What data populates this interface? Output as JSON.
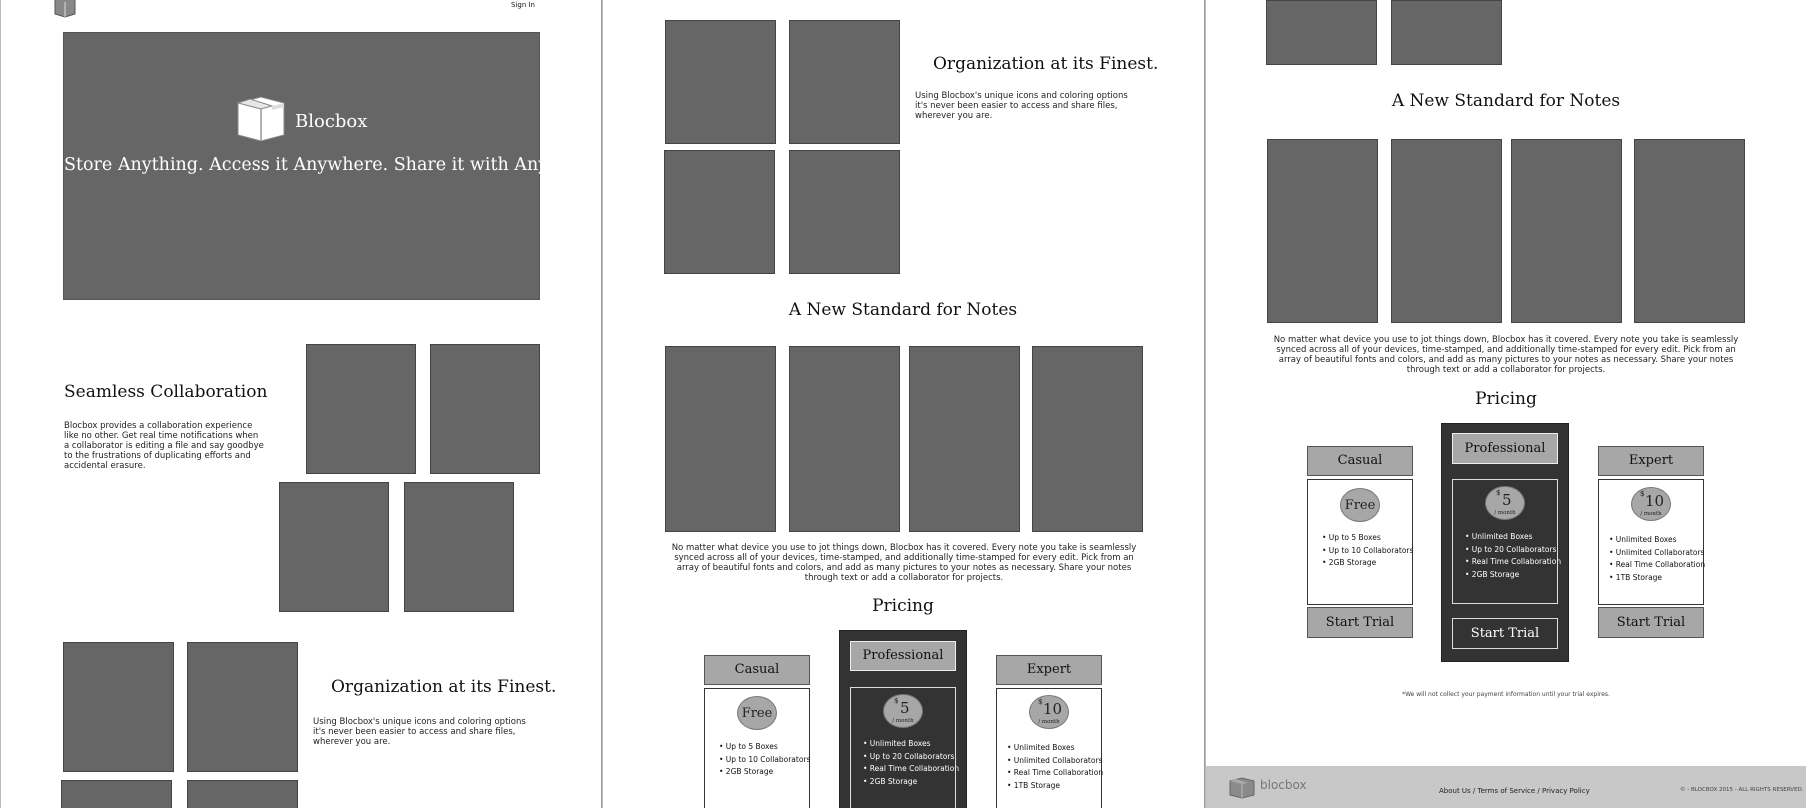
{
  "header": {
    "signin_label": "Sign In"
  },
  "hero": {
    "brand": "Blocbox",
    "tagline": "Store Anything. Access it Anywhere. Share it with Anyone."
  },
  "collaboration": {
    "title": "Seamless Collaboration",
    "body": "Blocbox provides a collaboration experience like no other. Get real time notifications when a collaborator is editing a file and say goodbye to the frustrations of duplicating efforts and accidental erasure."
  },
  "organization": {
    "title": "Organization at its Finest.",
    "body": "Using Blocbox's unique icons and coloring options it's never been easier to access and share files, wherever you are."
  },
  "notes": {
    "title": "A New Standard for Notes",
    "body": "No matter what device you use to jot things down, Blocbox has it covered. Every note you take is seamlessly synced across all of your devices, time-stamped, and additionally time-stamped for every edit. Pick from an array of beautiful fonts and colors, and add as many pictures to your notes as necessary. Share your notes through text or add a collaborator for projects."
  },
  "pricing": {
    "title": "Pricing",
    "tiers": [
      {
        "name": "Casual",
        "price": "Free",
        "currency": "",
        "period": "",
        "features": [
          "• Up to 5 Boxes",
          "• Up to 10 Collaborators",
          "• 2GB Storage"
        ],
        "cta": "Start Trial"
      },
      {
        "name": "Professional",
        "price": "5",
        "currency": "$",
        "period": "/ month",
        "features": [
          "• Unlimited Boxes",
          "• Up to 20 Collaborators",
          "• Real Time Collaboration",
          "• 2GB Storage"
        ],
        "cta": "Start Trial"
      },
      {
        "name": "Expert",
        "price": "10",
        "currency": "$",
        "period": "/ month",
        "features": [
          "• Unlimited Boxes",
          "• Unlimited Collaborators",
          "• Real Time Collaboration",
          "• 1TB Storage"
        ],
        "cta": "Start Trial"
      }
    ],
    "disclaimer": "*We will not collect your payment information until your trial expires."
  },
  "footer": {
    "brand": "blocbox",
    "links": [
      "About Us",
      "Terms of Service",
      "Privacy Policy"
    ],
    "link_separator": " / ",
    "copyright": "© - BLOCBOX 2015 - ALL RIGHTS RESERVED."
  },
  "colors": {
    "placeholder_gray": "#666666",
    "tier_gray": "#a7a7a7",
    "pro_dark": "#333333",
    "footer_gray": "#c8c8c8"
  },
  "icons": {
    "logo": "box-logo-icon"
  }
}
